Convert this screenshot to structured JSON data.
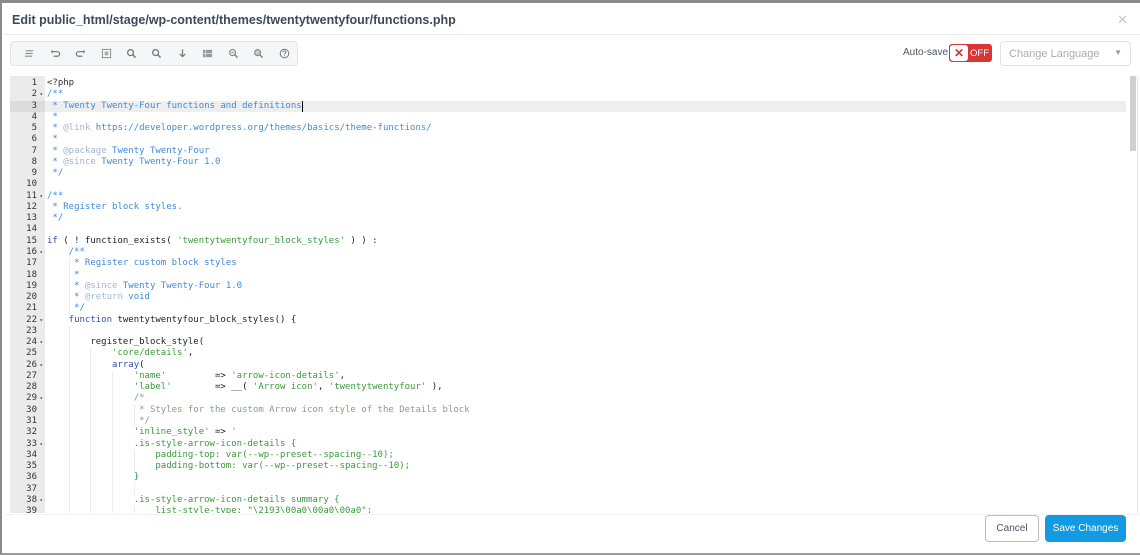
{
  "dialog": {
    "title": "Edit public_html/stage/wp-content/themes/twentytwentyfour/functions.php",
    "close_icon": "close-icon"
  },
  "toolbar": {
    "buttons": [
      {
        "name": "format-code",
        "icon": "format-lines-icon"
      },
      {
        "name": "undo",
        "icon": "undo-icon"
      },
      {
        "name": "redo",
        "icon": "redo-icon"
      },
      {
        "name": "select-all",
        "icon": "select-all-icon"
      },
      {
        "name": "find",
        "icon": "search-icon"
      },
      {
        "name": "replace",
        "icon": "search-replace-icon"
      },
      {
        "name": "goto-line",
        "icon": "arrow-down-icon"
      },
      {
        "name": "toggle-panel",
        "icon": "panel-icon"
      },
      {
        "name": "zoom-out",
        "icon": "zoom-out-icon"
      },
      {
        "name": "zoom-in",
        "icon": "zoom-in-icon"
      },
      {
        "name": "help",
        "icon": "help-icon"
      }
    ]
  },
  "autosave": {
    "label": "Auto-save",
    "state": "OFF",
    "knob_glyph": "✕",
    "color": "#d93535"
  },
  "language": {
    "placeholder": "Change Language",
    "chevron": "⌄"
  },
  "editor": {
    "active_line": 3,
    "lines": [
      {
        "n": "1",
        "fold": false,
        "segs": [
          [
            "t-meta",
            "<?php"
          ]
        ]
      },
      {
        "n": "2",
        "fold": true,
        "segs": [
          [
            "t-cm",
            "/**"
          ]
        ]
      },
      {
        "n": "3",
        "fold": false,
        "segs": [
          [
            "t-cm",
            " * Twenty Twenty-Four functions and definitions"
          ]
        ]
      },
      {
        "n": "4",
        "fold": false,
        "segs": [
          [
            "t-cm",
            " *"
          ]
        ]
      },
      {
        "n": "5",
        "fold": false,
        "segs": [
          [
            "t-cm",
            " * "
          ],
          [
            "t-cmk",
            "@link"
          ],
          [
            "t-cm",
            " https://developer.wordpress.org/themes/basics/theme-functions/"
          ]
        ]
      },
      {
        "n": "6",
        "fold": false,
        "segs": [
          [
            "t-cm",
            " *"
          ]
        ]
      },
      {
        "n": "7",
        "fold": false,
        "segs": [
          [
            "t-cm",
            " * "
          ],
          [
            "t-cmk",
            "@package"
          ],
          [
            "t-cm",
            " Twenty Twenty-Four"
          ]
        ]
      },
      {
        "n": "8",
        "fold": false,
        "segs": [
          [
            "t-cm",
            " * "
          ],
          [
            "t-cmk",
            "@since"
          ],
          [
            "t-cm",
            " Twenty Twenty-Four 1.0"
          ]
        ]
      },
      {
        "n": "9",
        "fold": false,
        "segs": [
          [
            "t-cm",
            " */"
          ]
        ]
      },
      {
        "n": "10",
        "fold": false,
        "segs": []
      },
      {
        "n": "11",
        "fold": true,
        "segs": [
          [
            "t-cm",
            "/**"
          ]
        ]
      },
      {
        "n": "12",
        "fold": false,
        "segs": [
          [
            "t-cm",
            " * Register block styles."
          ]
        ]
      },
      {
        "n": "13",
        "fold": false,
        "segs": [
          [
            "t-cm",
            " */"
          ]
        ]
      },
      {
        "n": "14",
        "fold": false,
        "segs": []
      },
      {
        "n": "15",
        "fold": false,
        "segs": [
          [
            "t-kw",
            "if"
          ],
          [
            "t-fn",
            " ( ! function_exists( "
          ],
          [
            "t-str",
            "'twentytwentyfour_block_styles'"
          ],
          [
            "t-fn",
            " ) ) :"
          ]
        ]
      },
      {
        "n": "16",
        "fold": true,
        "segs": [
          [
            "t-cm",
            "    /**"
          ]
        ]
      },
      {
        "n": "17",
        "fold": false,
        "segs": [
          [
            "t-cm",
            "     * Register custom block styles"
          ]
        ]
      },
      {
        "n": "18",
        "fold": false,
        "segs": [
          [
            "t-cm",
            "     *"
          ]
        ]
      },
      {
        "n": "19",
        "fold": false,
        "segs": [
          [
            "t-cm",
            "     * "
          ],
          [
            "t-cmk",
            "@since"
          ],
          [
            "t-cm",
            " Twenty Twenty-Four 1.0"
          ]
        ]
      },
      {
        "n": "20",
        "fold": false,
        "segs": [
          [
            "t-cm",
            "     * "
          ],
          [
            "t-cmk",
            "@return"
          ],
          [
            "t-cm",
            " void"
          ]
        ]
      },
      {
        "n": "21",
        "fold": false,
        "segs": [
          [
            "t-cm",
            "     */"
          ]
        ]
      },
      {
        "n": "22",
        "fold": true,
        "segs": [
          [
            "t-kw",
            "    function"
          ],
          [
            "t-fn",
            " twentytwentyfour_block_styles() {"
          ]
        ]
      },
      {
        "n": "23",
        "fold": false,
        "segs": []
      },
      {
        "n": "24",
        "fold": true,
        "segs": [
          [
            "t-fn",
            "        register_block_style("
          ]
        ]
      },
      {
        "n": "25",
        "fold": false,
        "segs": [
          [
            "t-str",
            "            'core/details'"
          ],
          [
            "t-fn",
            ","
          ]
        ]
      },
      {
        "n": "26",
        "fold": true,
        "segs": [
          [
            "t-kw",
            "            array"
          ],
          [
            "t-fn",
            "("
          ]
        ]
      },
      {
        "n": "27",
        "fold": false,
        "segs": [
          [
            "t-str",
            "                'name'"
          ],
          [
            "t-fn",
            "         => "
          ],
          [
            "t-str",
            "'arrow-icon-details'"
          ],
          [
            "t-fn",
            ","
          ]
        ]
      },
      {
        "n": "28",
        "fold": false,
        "segs": [
          [
            "t-str",
            "                'label'"
          ],
          [
            "t-fn",
            "        => __( "
          ],
          [
            "t-str",
            "'Arrow icon'"
          ],
          [
            "t-fn",
            ", "
          ],
          [
            "t-str",
            "'twentytwentyfour'"
          ],
          [
            "t-fn",
            " ),"
          ]
        ]
      },
      {
        "n": "29",
        "fold": true,
        "segs": [
          [
            "t-gcm",
            "                /*"
          ]
        ]
      },
      {
        "n": "30",
        "fold": false,
        "segs": [
          [
            "t-gcm",
            "                 * Styles for the custom Arrow icon style of the Details block"
          ]
        ]
      },
      {
        "n": "31",
        "fold": false,
        "segs": [
          [
            "t-gcm",
            "                 */"
          ]
        ]
      },
      {
        "n": "32",
        "fold": false,
        "segs": [
          [
            "t-str",
            "                'inline_style'"
          ],
          [
            "t-fn",
            " => "
          ],
          [
            "t-str",
            "'"
          ]
        ]
      },
      {
        "n": "33",
        "fold": true,
        "segs": [
          [
            "t-css",
            "                .is-style-arrow-icon-details {"
          ]
        ]
      },
      {
        "n": "34",
        "fold": false,
        "segs": [
          [
            "t-css",
            "                    padding-top: var(--wp--preset--spacing--10);"
          ]
        ]
      },
      {
        "n": "35",
        "fold": false,
        "segs": [
          [
            "t-css",
            "                    padding-bottom: var(--wp--preset--spacing--10);"
          ]
        ]
      },
      {
        "n": "36",
        "fold": false,
        "segs": [
          [
            "t-css",
            "                }"
          ]
        ]
      },
      {
        "n": "37",
        "fold": false,
        "segs": []
      },
      {
        "n": "38",
        "fold": true,
        "segs": [
          [
            "t-css",
            "                .is-style-arrow-icon-details summary {"
          ]
        ]
      },
      {
        "n": "39",
        "fold": false,
        "segs": [
          [
            "t-css",
            "                    list-style-type: \"\\2193\\00a0\\00a0\\00a0\";"
          ]
        ]
      }
    ]
  },
  "footer": {
    "cancel_label": "Cancel",
    "save_label": "Save Changes",
    "save_color": "#129be3"
  }
}
